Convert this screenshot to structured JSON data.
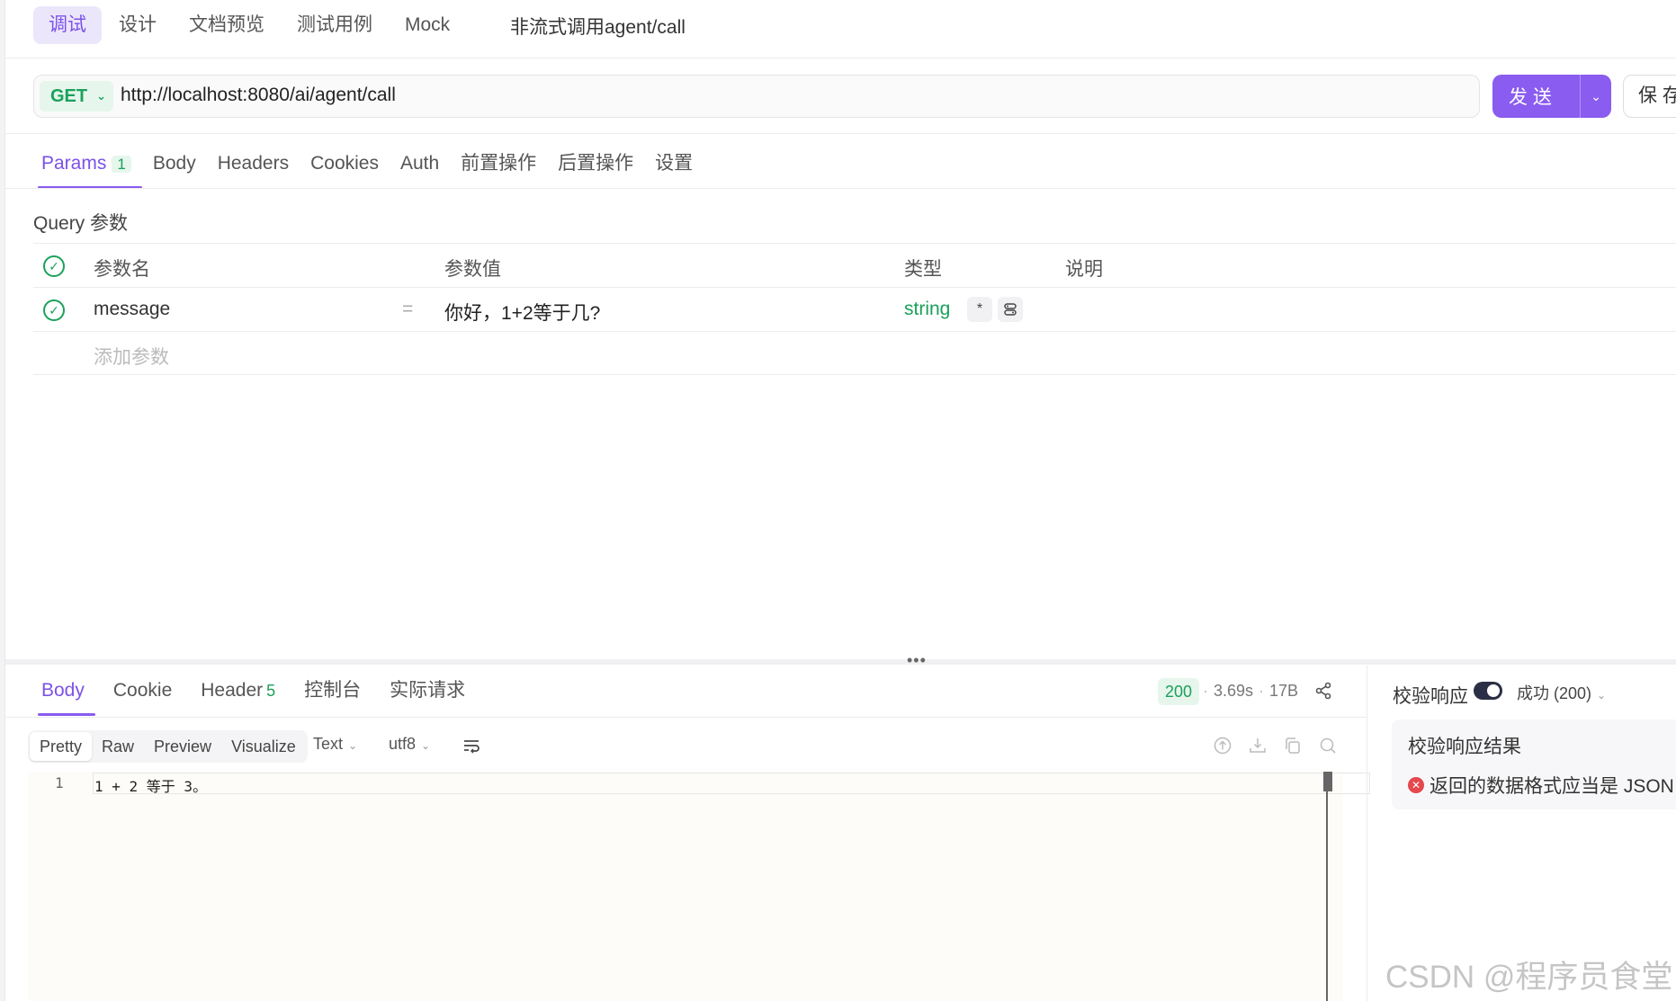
{
  "top_tabs": [
    "调试",
    "设计",
    "文档预览",
    "测试用例",
    "Mock"
  ],
  "api_title": "非流式调用agent/call",
  "request": {
    "method": "GET",
    "url": "http://localhost:8080/ai/agent/call",
    "send_label": "发 送",
    "save_label": "保 存"
  },
  "request_tabs": {
    "params": "Params",
    "params_count": "1",
    "others": [
      "Body",
      "Headers",
      "Cookies",
      "Auth",
      "前置操作",
      "后置操作",
      "设置"
    ]
  },
  "query_section_title": "Query 参数",
  "params_table": {
    "headers": [
      "参数名",
      "参数值",
      "类型",
      "说明"
    ],
    "rows": [
      {
        "name": "message",
        "eq": "=",
        "value": "你好，1+2等于几?",
        "type": "string",
        "required_mark": "*"
      }
    ],
    "add_placeholder": "添加参数"
  },
  "splitter_dots": "•••",
  "response_tabs": {
    "body": "Body",
    "cookie": "Cookie",
    "header": "Header",
    "header_count": "5",
    "console": "控制台",
    "actual_request": "实际请求"
  },
  "response_meta": {
    "status": "200",
    "time": "3.69s",
    "size": "17B",
    "separator": "·"
  },
  "view_modes": [
    "Pretty",
    "Raw",
    "Preview",
    "Visualize"
  ],
  "format": "Text",
  "encoding": "utf8",
  "response_body": [
    {
      "line": "1",
      "code": "1 + 2 等于 3。"
    }
  ],
  "validation": {
    "label": "校验响应",
    "status": "成功 (200)",
    "result_title": "校验响应结果",
    "error_message": "返回的数据格式应当是 JSON"
  },
  "watermark": "CSDN @程序员食堂",
  "colors": {
    "accent": "#8a5cf0",
    "success": "#1aa15a",
    "error": "#e5484d"
  }
}
